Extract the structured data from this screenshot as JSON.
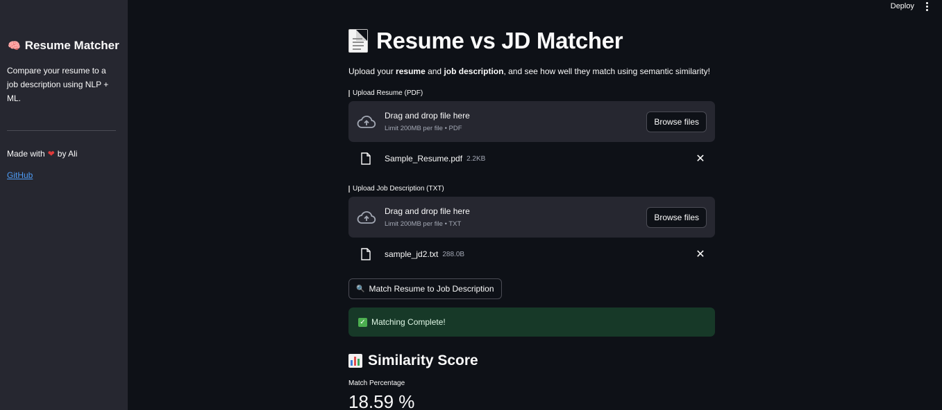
{
  "topbar": {
    "deploy_label": "Deploy"
  },
  "sidebar": {
    "title": "Resume Matcher",
    "title_emoji": "🧠",
    "description": "Compare your resume to a job description using NLP + ML.",
    "made_with_prefix": "Made with",
    "heart": "❤",
    "made_with_suffix": "by Ali",
    "github_link": "GitHub"
  },
  "main": {
    "title": "Resume vs JD Matcher",
    "intro": {
      "part1": "Upload your ",
      "bold1": "resume",
      "part2": " and ",
      "bold2": "job description",
      "part3": ", and see how well they match using semantic similarity!"
    },
    "resume_upload": {
      "label": "Upload Resume (PDF)",
      "drag_text": "Drag and drop file here",
      "limit_text": "Limit 200MB per file • PDF",
      "browse_label": "Browse files",
      "file_name": "Sample_Resume.pdf",
      "file_size": "2.2KB"
    },
    "jd_upload": {
      "label": "Upload Job Description (TXT)",
      "drag_text": "Drag and drop file here",
      "limit_text": "Limit 200MB per file • TXT",
      "browse_label": "Browse files",
      "file_name": "sample_jd2.txt",
      "file_size": "288.0B"
    },
    "match_button": {
      "icon": "🔍",
      "label": "Match Resume to Job Description"
    },
    "success_alert": "Matching Complete!",
    "score_section": {
      "title": "Similarity Score",
      "metric_label": "Match Percentage",
      "metric_value": "18.59 %"
    }
  },
  "colors": {
    "background": "#0e1117",
    "sidebar": "#262730",
    "success_bg": "#173928",
    "link": "#4e9cf5"
  }
}
